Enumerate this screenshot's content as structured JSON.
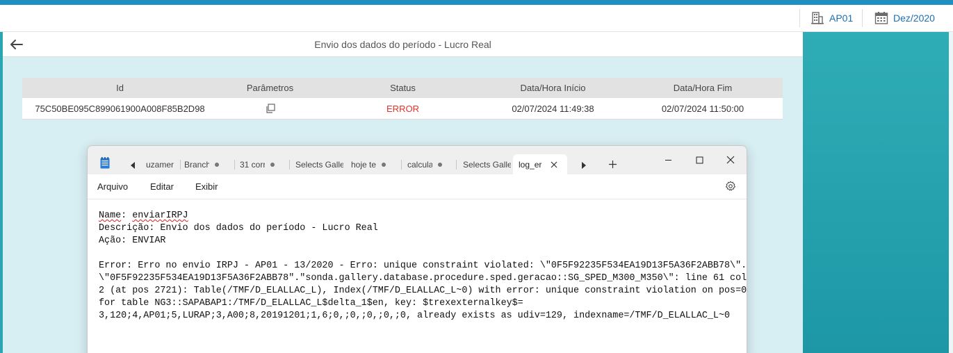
{
  "topbar": {
    "company": {
      "icon": "building-icon",
      "label": "AP01"
    },
    "period": {
      "icon": "calendar-icon",
      "label": "Dez/2020"
    }
  },
  "page": {
    "title": "Envio dos dados do período - Lucro Real",
    "back_icon": "arrow-left-icon"
  },
  "table": {
    "headers": [
      "Id",
      "Parâmetros",
      "Status",
      "Data/Hora Início",
      "Data/Hora Fim"
    ],
    "rows": [
      {
        "id": "75C50BE095C899061900A008F85B2D98",
        "params_icon": "copy-icon",
        "status": "ERROR",
        "start": "02/07/2024 11:49:38",
        "end": "02/07/2024 11:50:00"
      }
    ]
  },
  "colors": {
    "accent_top": "#1e8fc0",
    "link": "#1b6fb3",
    "teal_panel": "#2aa8b3",
    "status_error": "#e0322a"
  },
  "notepad": {
    "tabs": [
      {
        "label": "uzamer",
        "dot": false
      },
      {
        "label": "Branch",
        "dot": true
      },
      {
        "label": "31 corr",
        "dot": true
      },
      {
        "label": "Selects Galle",
        "dot": false
      },
      {
        "label": "hoje te",
        "dot": true
      },
      {
        "label": "calcula",
        "dot": true
      },
      {
        "label": "Selects Galle",
        "dot": false
      }
    ],
    "active_tab": "log_er",
    "menu": [
      "Arquivo",
      "Editar",
      "Exibir"
    ],
    "content": {
      "l1_label": "Name",
      "l1_value": "enviarIRPJ",
      "l2": "Descrição: Envio dos dados do período - Lucro Real",
      "l3": "Ação: ENVIAR",
      "e1": "Error: Erro no envio IRPJ - AP01 - 13/2020 - Erro: unique constraint violated: \\\"0F5F92235F534EA19D13F5A36F2ABB78\\\".",
      "e2": "\\\"0F5F92235F534EA19D13F5A36F2ABB78\".\"sonda.gallery.database.procedure.sped.geracao::SG_SPED_M300_M350\\\": line 61 col",
      "e3": "2 (at pos 2721): Table(/TMF/D_ELALLAC_L), Index(/TMF/D_ELALLAC_L~0) with error: unique constraint violation on pos=0",
      "e4": "for table NG3::SAPABAP1:/TMF/D_ELALLAC_L$delta_1$en, key: $trexexternalkey$=",
      "e5": "3,120;4,AP01;5,LURAP;3,A00;8,20191201;1,6;0,;0,;0,;0,;0, already exists as udiv=129, indexname=/TMF/D_ELALLAC_L~0"
    }
  }
}
